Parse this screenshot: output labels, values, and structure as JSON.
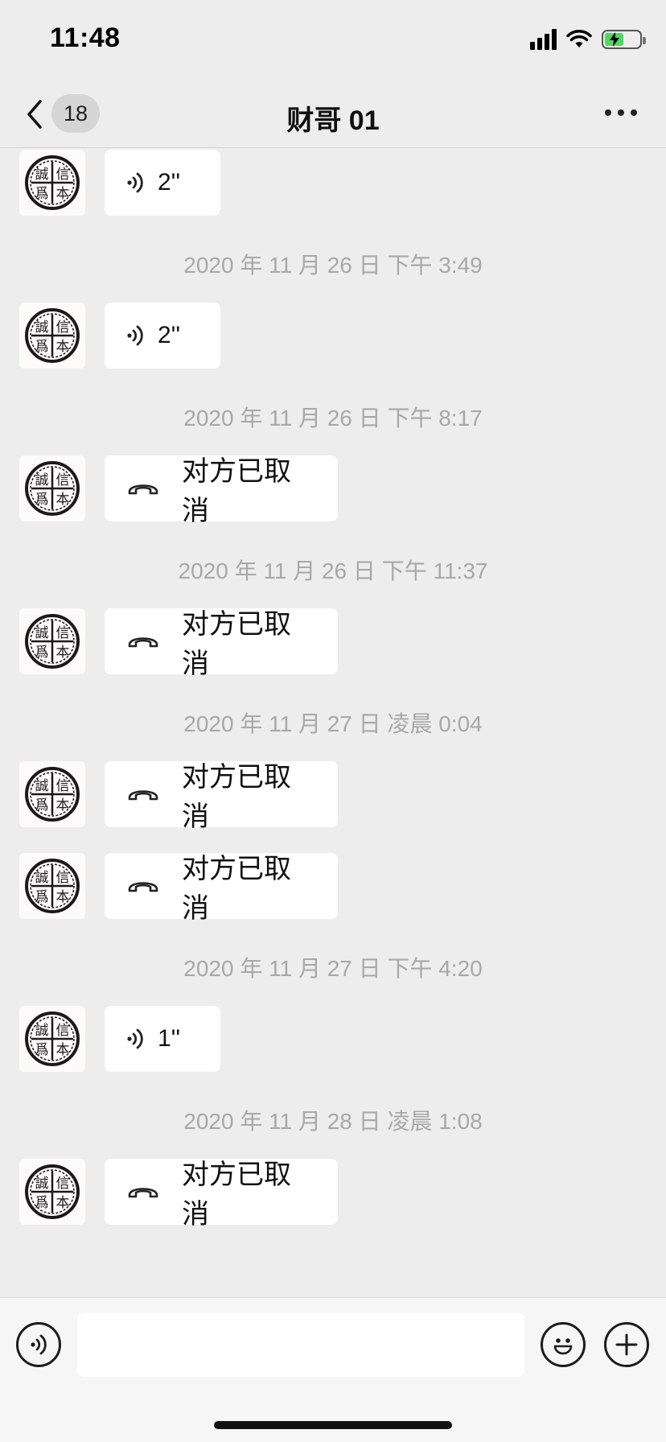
{
  "status_bar": {
    "time": "11:48"
  },
  "nav": {
    "badge_count": "18",
    "title": "财哥 01"
  },
  "avatar_text": {
    "tl": "誠",
    "tr": "信",
    "bl": "爲",
    "br": "本"
  },
  "messages": [
    {
      "kind": "voice",
      "text": "2''"
    },
    {
      "kind": "timestamp",
      "text": "2020 年 11 月 26 日 下午 3:49"
    },
    {
      "kind": "voice",
      "text": "2''"
    },
    {
      "kind": "timestamp",
      "text": "2020 年 11 月 26 日 下午 8:17"
    },
    {
      "kind": "call",
      "text": "对方已取消"
    },
    {
      "kind": "timestamp",
      "text": "2020 年 11 月 26 日 下午 11:37"
    },
    {
      "kind": "call",
      "text": "对方已取消"
    },
    {
      "kind": "timestamp",
      "text": "2020 年 11 月 27 日 凌晨 0:04"
    },
    {
      "kind": "call",
      "text": "对方已取消"
    },
    {
      "kind": "call",
      "text": "对方已取消"
    },
    {
      "kind": "timestamp",
      "text": "2020 年 11 月 27 日 下午 4:20"
    },
    {
      "kind": "voice",
      "text": "1''"
    },
    {
      "kind": "timestamp",
      "text": "2020 年 11 月 28 日 凌晨 1:08"
    },
    {
      "kind": "call",
      "text": "对方已取消"
    }
  ],
  "input": {
    "placeholder": "",
    "value": ""
  },
  "icons": {
    "back": "chevron-left-icon",
    "more": "more-dots-icon",
    "voice_message": "voice-wave-icon",
    "cancelled_call": "hangup-phone-icon",
    "voice_input": "voice-input-icon",
    "emoji": "emoji-icon",
    "plus": "plus-icon",
    "wifi": "wifi-icon",
    "signal": "signal-icon",
    "battery": "battery-charging-icon"
  },
  "colors": {
    "background": "#ededed",
    "bubble": "#ffffff",
    "timestamp": "#a8a8a8",
    "battery": "#4cd964"
  }
}
